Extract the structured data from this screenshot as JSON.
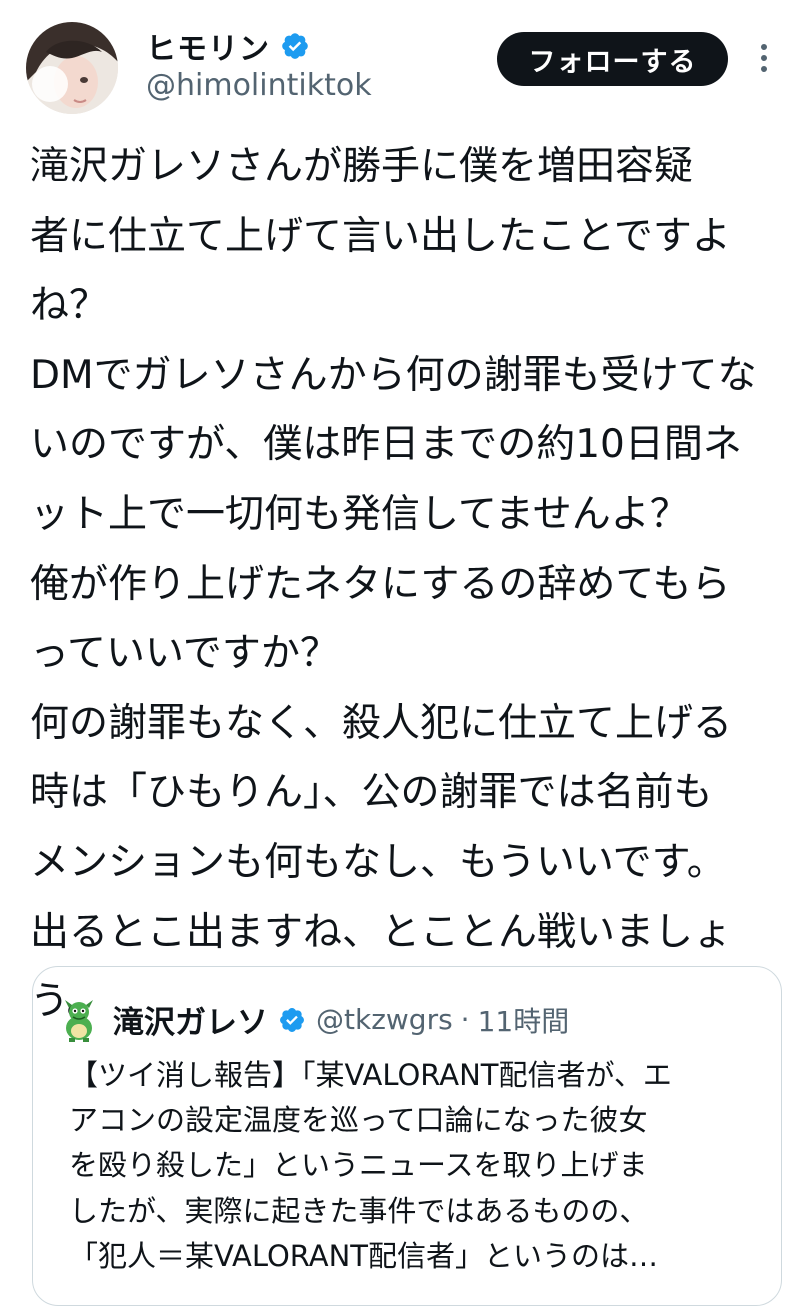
{
  "author": {
    "display_name": "ヒモリン",
    "handle": "@himolintiktok",
    "verified_icon": "verified-badge-icon",
    "avatar_icon": "avatar"
  },
  "actions": {
    "follow_label": "フォローする",
    "more_icon": "more-vertical-icon"
  },
  "tweet": {
    "text": "滝沢ガレソさんが勝手に僕を増田容疑\n者に仕立て上げて言い出したことですよ\nね？\nDMでガレソさんから何の謝罪も受けてな\nいのですが、僕は昨日までの約10日間ネ\nット上で一切何も発信してませんよ？\n俺が作り上げたネタにするの辞めてもら\nっていいですか？\n何の謝罪もなく、殺人犯に仕立て上げる\n時は「ひもりん」、公の謝罪では名前も\nメンションも何もなし、もういいです。\n出るとこ出ますね、とことん戦いましょ\nう。"
  },
  "quote": {
    "display_name": "滝沢ガレソ",
    "handle": "@tkzwgrs",
    "separator": "·",
    "time": "11時間",
    "avatar_icon": "dragon-avatar-icon",
    "text": "【ツイ消し報告】「某VALORANT配信者が、エ\nアコンの設定温度を巡って口論になった彼女\nを殴り殺した」というニュースを取り上げま\nしたが、実際に起きた事件ではあるものの、\n「犯人＝某VALORANT配信者」というのは…"
  },
  "colors": {
    "text_primary": "#0f1419",
    "text_secondary": "#536471",
    "verified_blue": "#1d9bf0",
    "follow_bg": "#0f1419",
    "border": "#cfd9de"
  }
}
